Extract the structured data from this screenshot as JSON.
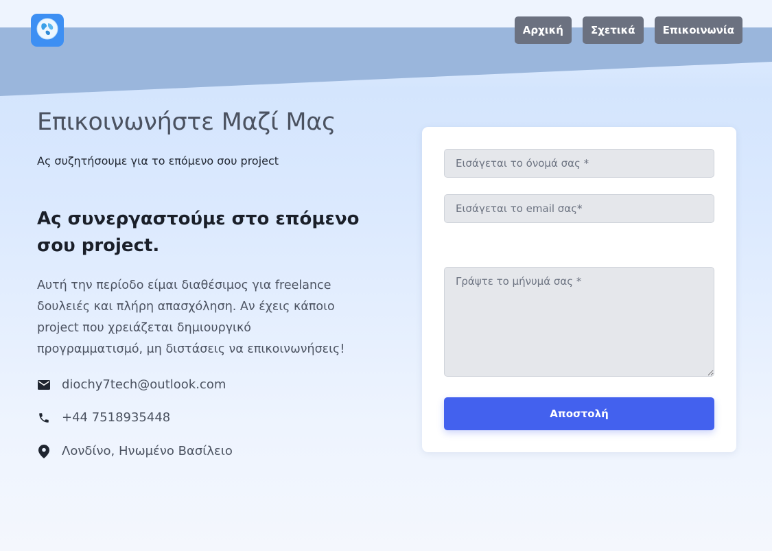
{
  "header": {
    "logo_icon": "globe-icon",
    "nav": [
      {
        "label": "Αρχική"
      },
      {
        "label": "Σχετικά"
      },
      {
        "label": "Επικοινωνία"
      }
    ]
  },
  "contact": {
    "title": "Επικοινωνήστε Μαζί Μας",
    "subtitle": "Ας συζητήσουμε για το επόμενο σου project",
    "heading": "Ας συνεργαστούμε στο επόμενο σου project.",
    "description": "Αυτή την περίοδο είμαι διαθέσιμος για freelance δουλειές και πλήρη απασχόληση. Αν έχεις κάποιο project που χρειάζεται δημιουργικό προγραμματισμό, μη διστάσεις να επικοινωνήσεις!",
    "items": [
      {
        "icon": "mail-icon",
        "text": "diochy7tech@outlook.com"
      },
      {
        "icon": "phone-icon",
        "text": "+44 7518935448"
      },
      {
        "icon": "location-pin-icon",
        "text": "Λονδίνο, Ηνωμένο Βασίλειο"
      }
    ]
  },
  "form": {
    "name_placeholder": "Εισάγεται το όνομά σας *",
    "email_placeholder": "Εισάγεται το email σας*",
    "message_placeholder": "Γράψτε το μήνυμά σας *",
    "submit_label": "Αποστολή"
  },
  "colors": {
    "accent": "#4361ee",
    "nav_button": "#6b7180",
    "banner": "#9ab6dc",
    "logo_bg": "#3d8ff3"
  }
}
